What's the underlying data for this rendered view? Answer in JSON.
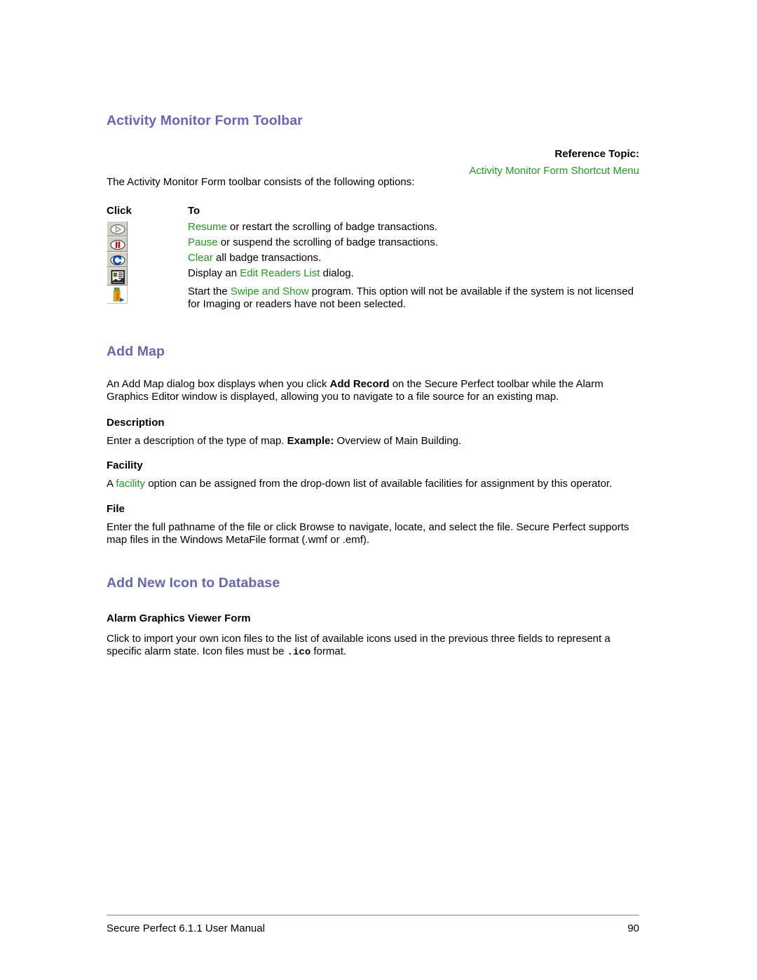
{
  "document": {
    "heading1": "Activity Monitor Form Toolbar",
    "heading2": "Add Map",
    "heading3": "Add New Icon to Database"
  },
  "reference": {
    "label": "Reference Topic:",
    "link": "Activity Monitor Form Shortcut Menu"
  },
  "toolbar_section": {
    "intro": "The Activity Monitor Form toolbar consists of the following options:",
    "columns": {
      "click": "Click",
      "to": "To"
    },
    "rows": [
      {
        "icon": "resume-play-icon",
        "link": "Resume",
        "rest": " or restart the scrolling of badge transactions."
      },
      {
        "icon": "pause-icon",
        "link": "Pause",
        "rest": " or suspend the scrolling of badge transactions."
      },
      {
        "icon": "clear-refresh-icon",
        "link": "Clear",
        "rest": " all badge transactions."
      },
      {
        "icon": "edit-readers-list-icon",
        "prefix": "Display an ",
        "link": "Edit Readers List",
        "rest": " dialog."
      },
      {
        "icon": "swipe-and-show-icon",
        "prefix": "Start the ",
        "link": "Swipe and Show",
        "rest": " program. This option will not be available if the system is not licensed for Imaging or readers have not been selected."
      }
    ]
  },
  "add_map": {
    "intro_part1": "An Add Map dialog box displays when you click ",
    "intro_bold": "Add Record",
    "intro_part2": " on the Secure Perfect toolbar while the Alarm Graphics Editor window is displayed, allowing you to navigate to a file source for an existing map.",
    "description_heading": "Description",
    "description_part1": "Enter a description of the type of map. ",
    "description_bold": "Example:",
    "description_part2": " Overview of Main Building.",
    "facility_heading": "Facility",
    "facility_part1": "A ",
    "facility_link": "facility",
    "facility_part2": " option can be assigned from the drop-down list of available facilities for assignment by this operator.",
    "file_heading": "File",
    "file_text": "Enter the full pathname of the file or click Browse to navigate, locate, and select the file. Secure Perfect supports map files in the Windows MetaFile format (.wmf or .emf)."
  },
  "add_new_icon": {
    "subheading": "Alarm Graphics Viewer Form",
    "body_part1": "Click to import your own icon files to the list of available icons used in the previous three fields to represent a specific alarm state. Icon files must be ",
    "body_mono": ".ico",
    "body_part2": " format."
  },
  "footer": {
    "manual_title": "Secure Perfect 6.1.1 User Manual",
    "page_number": "90"
  },
  "colors": {
    "heading": "#6666b3",
    "link": "#1f9b1f",
    "text": "#000000",
    "rule": "#808080"
  }
}
